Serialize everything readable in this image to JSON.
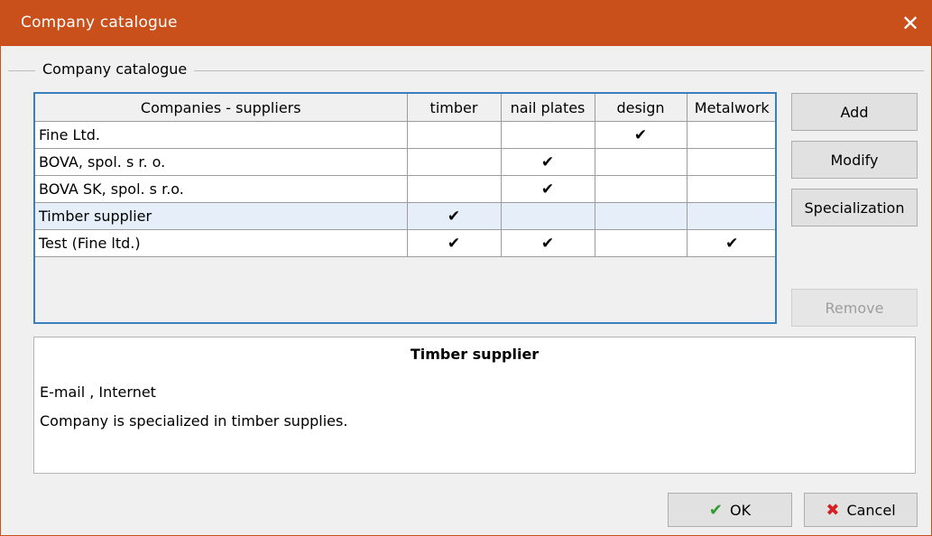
{
  "window": {
    "title": "Company catalogue",
    "close_glyph": "✕",
    "accent_color": "#c9501a"
  },
  "group": {
    "label": "Company catalogue"
  },
  "table": {
    "headers": [
      "Companies - suppliers",
      "timber",
      "nail plates",
      "design",
      "Metalwork"
    ],
    "rows": [
      {
        "name": "Fine Ltd.",
        "timber": "",
        "nail_plates": "",
        "design": "✔",
        "metalwork": ""
      },
      {
        "name": "BOVA, spol. s r. o.",
        "timber": "",
        "nail_plates": "✔",
        "design": "",
        "metalwork": ""
      },
      {
        "name": "BOVA SK, spol. s r.o.",
        "timber": "",
        "nail_plates": "✔",
        "design": "",
        "metalwork": ""
      },
      {
        "name": "Timber supplier",
        "timber": "✔",
        "nail_plates": "",
        "design": "",
        "metalwork": "",
        "selected": true
      },
      {
        "name": "Test (Fine ltd.)",
        "timber": "✔",
        "nail_plates": "✔",
        "design": "",
        "metalwork": "✔"
      }
    ]
  },
  "buttons": {
    "add": "Add",
    "modify": "Modify",
    "specialization": "Specialization",
    "remove": "Remove",
    "ok": "OK",
    "cancel": "Cancel",
    "ok_icon": "✔",
    "cancel_icon": "✖"
  },
  "detail": {
    "title": "Timber supplier",
    "contact": "E-mail  , Internet",
    "description": "Company is specialized in timber supplies."
  }
}
